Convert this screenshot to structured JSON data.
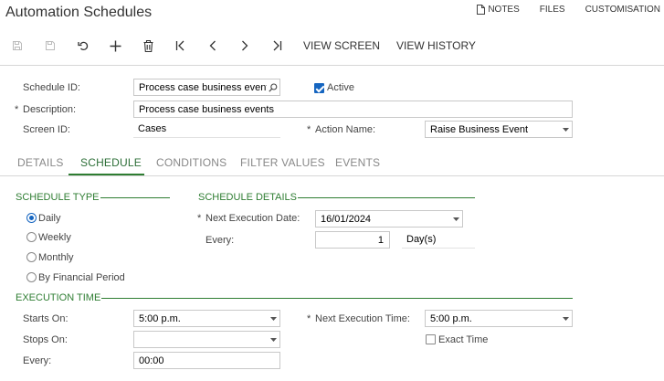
{
  "window": {
    "title": "Automation Schedules"
  },
  "top_links": {
    "notes": "NOTES",
    "files": "FILES",
    "customisation": "CUSTOMISATION"
  },
  "toolbar": {
    "view_screen": "VIEW SCREEN",
    "view_history": "VIEW HISTORY"
  },
  "form": {
    "schedule_id_label": "Schedule ID:",
    "schedule_id_value": "Process case business events",
    "active_label": "Active",
    "active_checked": true,
    "description_label": "Description:",
    "description_value": "Process case business events",
    "screen_id_label": "Screen ID:",
    "screen_id_value": "Cases",
    "action_name_label": "Action Name:",
    "action_name_value": "Raise Business Event",
    "required_mark": "*"
  },
  "tabs": [
    {
      "label": "DETAILS",
      "active": false
    },
    {
      "label": "SCHEDULE",
      "active": true
    },
    {
      "label": "CONDITIONS",
      "active": false
    },
    {
      "label": "FILTER VALUES",
      "active": false
    },
    {
      "label": "EVENTS",
      "active": false
    }
  ],
  "schedule_type": {
    "heading": "SCHEDULE TYPE",
    "options": [
      {
        "label": "Daily",
        "selected": true
      },
      {
        "label": "Weekly",
        "selected": false
      },
      {
        "label": "Monthly",
        "selected": false
      },
      {
        "label": "By Financial Period",
        "selected": false
      }
    ]
  },
  "schedule_details": {
    "heading": "SCHEDULE DETAILS",
    "next_execution_date_label": "Next Execution Date:",
    "next_execution_date_value": "16/01/2024",
    "every_label": "Every:",
    "every_value": "1",
    "every_unit": "Day(s)"
  },
  "execution_time": {
    "heading": "EXECUTION TIME",
    "starts_on_label": "Starts On:",
    "starts_on_value": "5:00 p.m.",
    "stops_on_label": "Stops On:",
    "stops_on_value": "",
    "every_label": "Every:",
    "every_value": "00:00",
    "next_execution_time_label": "Next Execution Time:",
    "next_execution_time_value": "5:00 p.m.",
    "exact_time_label": "Exact Time",
    "exact_time_checked": false
  },
  "colors": {
    "accent_green": "#2e7d32",
    "checkbox_blue": "#1565c0"
  },
  "icons": [
    "note-icon",
    "save-icon",
    "save-close-icon",
    "undo-icon",
    "add-icon",
    "delete-icon",
    "first-icon",
    "previous-icon",
    "next-icon",
    "last-icon",
    "search-icon",
    "chevron-down-icon"
  ]
}
